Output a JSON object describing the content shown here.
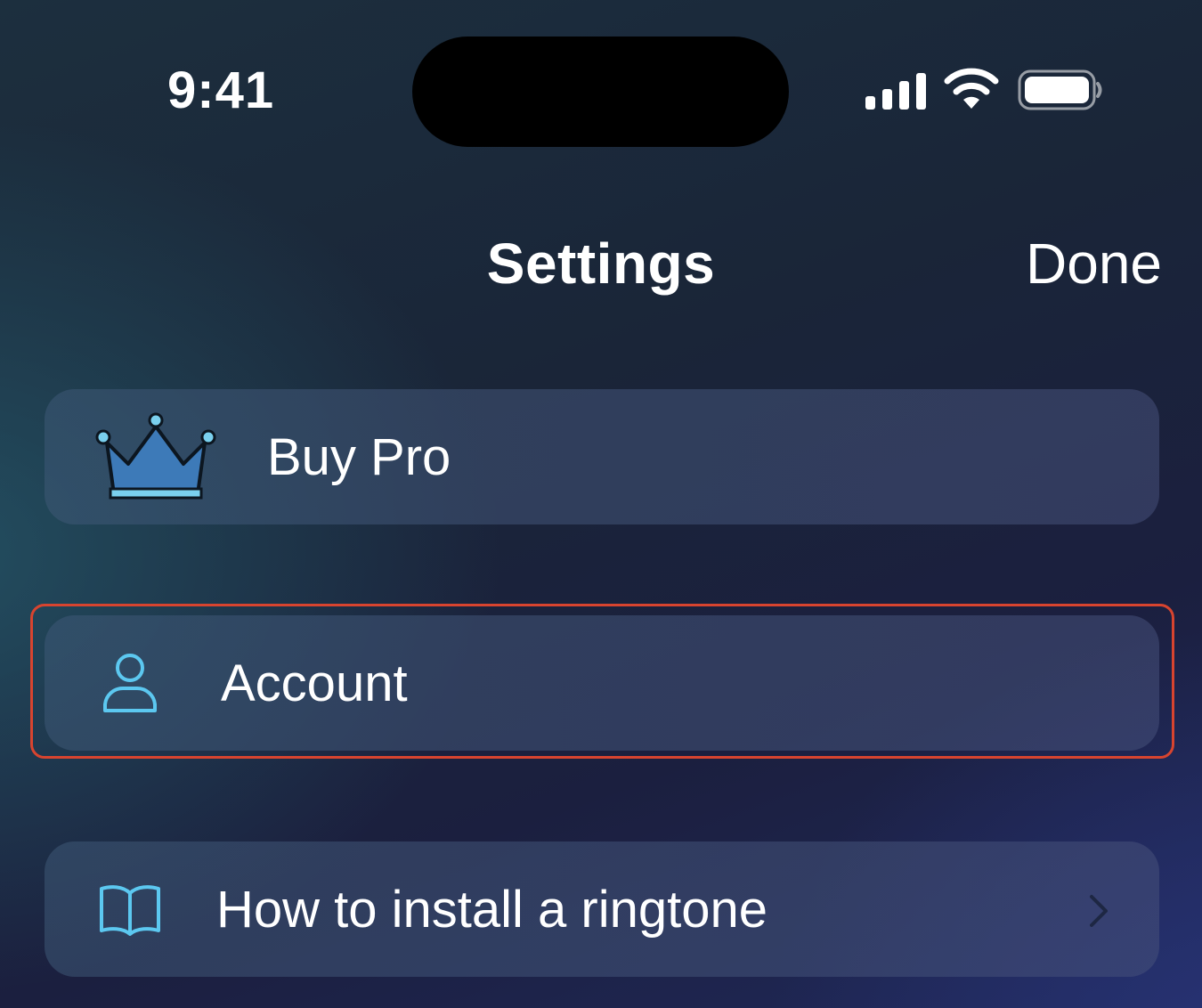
{
  "status_bar": {
    "time": "9:41",
    "signal_icon": "cellular-signal-icon",
    "wifi_icon": "wifi-icon",
    "battery_icon": "battery-full-icon"
  },
  "nav": {
    "title": "Settings",
    "done_label": "Done"
  },
  "rows": [
    {
      "label": "Buy Pro",
      "icon": "crown-icon",
      "icon_color": "#3d7ab8"
    },
    {
      "label": "Account",
      "icon": "person-icon",
      "icon_color": "#5cc8f0"
    },
    {
      "label": "How to install a ringtone",
      "icon": "book-icon",
      "icon_color": "#5cc8f0",
      "trailing_icon": "chevron-right-icon"
    }
  ],
  "colors": {
    "highlight": "#d8442f",
    "text": "#ffffff",
    "island": "#000000"
  }
}
